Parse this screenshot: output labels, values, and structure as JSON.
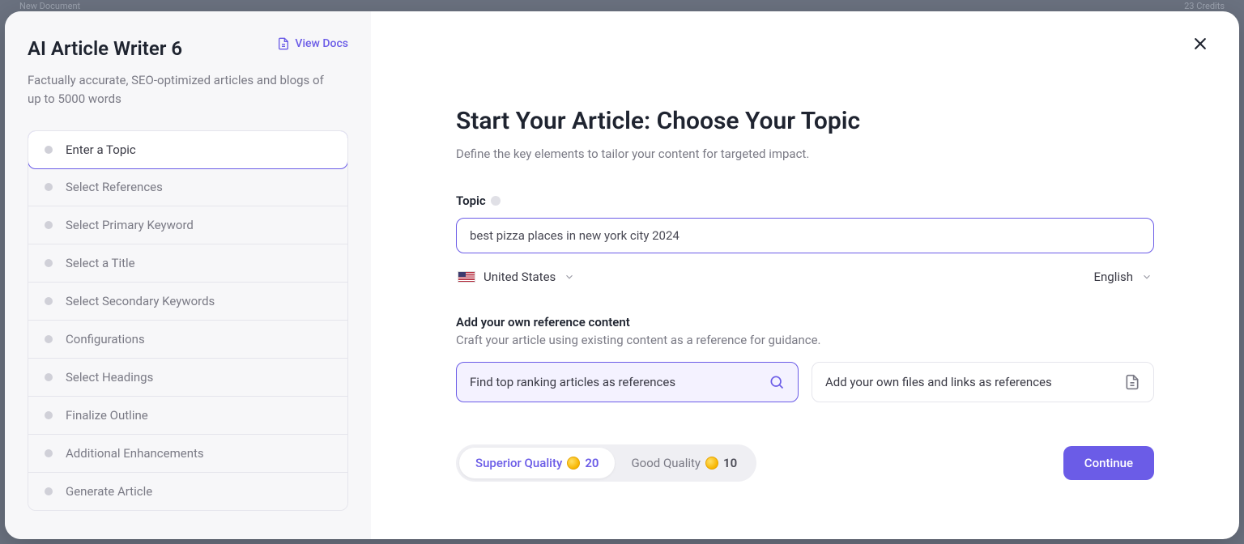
{
  "background": {
    "doc_label": "New Document",
    "credits_label": "23 Credits"
  },
  "sidebar": {
    "title": "AI Article Writer 6",
    "view_docs": "View Docs",
    "description": "Factually accurate, SEO-optimized articles and blogs of up to 5000 words",
    "steps": [
      "Enter a Topic",
      "Select References",
      "Select Primary Keyword",
      "Select a Title",
      "Select Secondary Keywords",
      "Configurations",
      "Select Headings",
      "Finalize Outline",
      "Additional Enhancements",
      "Generate Article"
    ],
    "active_step_index": 0
  },
  "main": {
    "title": "Start Your Article: Choose Your Topic",
    "subtitle": "Define the key elements to tailor your content for targeted impact.",
    "topic_label": "Topic",
    "topic_value": "best pizza places in new york city 2024",
    "country_label": "United States",
    "language_label": "English",
    "ref_title": "Add your own reference content",
    "ref_desc": "Craft your article using existing content as a reference for guidance.",
    "ref_option_1": "Find top ranking articles as references",
    "ref_option_2": "Add your own files and links as references",
    "quality_superior_label": "Superior Quality",
    "quality_superior_cost": "20",
    "quality_good_label": "Good Quality",
    "quality_good_cost": "10",
    "continue_label": "Continue"
  }
}
